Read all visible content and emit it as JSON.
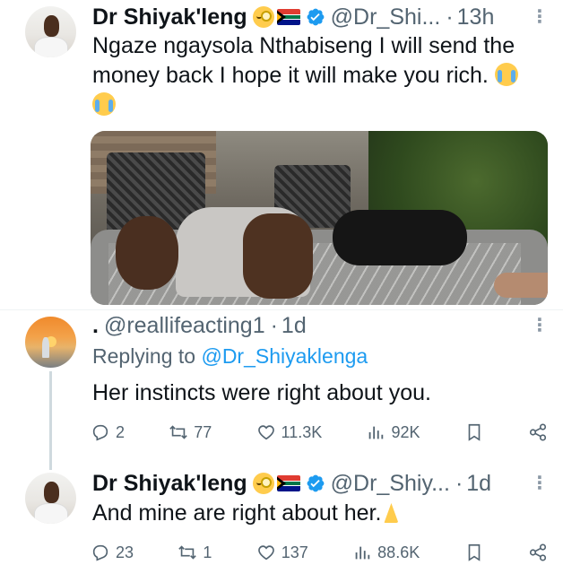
{
  "tweets": [
    {
      "author": "Dr Shiyak'leng",
      "handle": "@Dr_Shi...",
      "sep": "·",
      "time": "13h",
      "text": "Ngaze ngaysola Nthabiseng I will send the money back I hope it will make you rich.",
      "icons": [
        "face-with-monocle-emoji",
        "south-africa-flag-emoji",
        "verified-badge-icon",
        "loudly-crying-face-emoji"
      ]
    },
    {
      "author_prefix": ".",
      "handle": "@reallifeacting1",
      "sep": "·",
      "time": "1d",
      "replying_label": "Replying to",
      "replying_to": "@Dr_Shiyaklenga",
      "text": "Her instincts were right about you.",
      "stats": {
        "replies": "2",
        "retweets": "77",
        "likes": "11.3K",
        "views": "92K"
      }
    },
    {
      "author": "Dr Shiyak'leng",
      "handle": "@Dr_Shiy...",
      "sep": "·",
      "time": "1d",
      "text": "And mine are right about her.",
      "stats": {
        "replies": "23",
        "retweets": "1",
        "likes": "137",
        "views": "88.6K"
      }
    }
  ],
  "more_icon": "⋮",
  "colors": {
    "text": "#0f1419",
    "muted": "#536471",
    "link": "#1d9bf0",
    "verified": "#1d9bf0"
  }
}
